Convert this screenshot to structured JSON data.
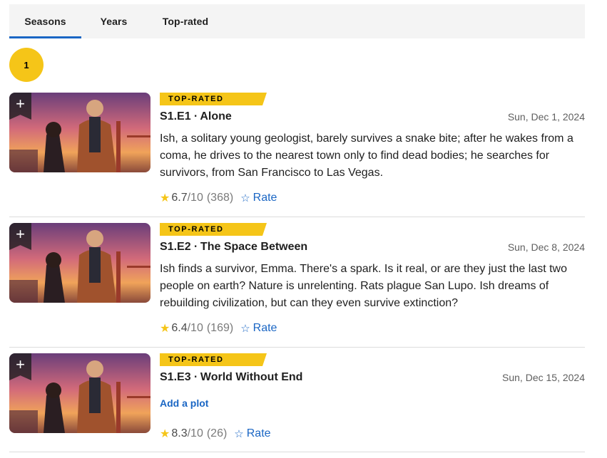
{
  "tabs": [
    {
      "label": "Seasons",
      "active": true
    },
    {
      "label": "Years",
      "active": false
    },
    {
      "label": "Top-rated",
      "active": false
    }
  ],
  "season_selector": {
    "current": "1"
  },
  "episodes": [
    {
      "badge": "TOP-RATED",
      "title": "S1.E1 ∙ Alone",
      "date": "Sun, Dec 1, 2024",
      "plot": "Ish, a solitary young geologist, barely survives a snake bite; after he wakes from a coma, he drives to the nearest town only to find dead bodies; he searches for survivors, from San Francisco to Las Vegas.",
      "rating": "6.7",
      "rating_max": "/10",
      "votes": "(368)",
      "rate_label": "Rate",
      "add_label": "+"
    },
    {
      "badge": "TOP-RATED",
      "title": "S1.E2 ∙ The Space Between",
      "date": "Sun, Dec 8, 2024",
      "plot": "Ish finds a survivor, Emma. There's a spark. Is it real, or are they just the last two people on earth? Nature is unrelenting. Rats plague San Lupo. Ish dreams of rebuilding civilization, but can they even survive extinction?",
      "rating": "6.4",
      "rating_max": "/10",
      "votes": "(169)",
      "rate_label": "Rate",
      "add_label": "+"
    },
    {
      "badge": "TOP-RATED",
      "title": "S1.E3 ∙ World Without End",
      "date": "Sun, Dec 15, 2024",
      "add_plot": "Add a plot",
      "rating": "8.3",
      "rating_max": "/10",
      "votes": "(26)",
      "rate_label": "Rate",
      "add_label": "+"
    }
  ],
  "colors": {
    "accent_yellow": "#f5c518",
    "link_blue": "#1a66c4"
  }
}
